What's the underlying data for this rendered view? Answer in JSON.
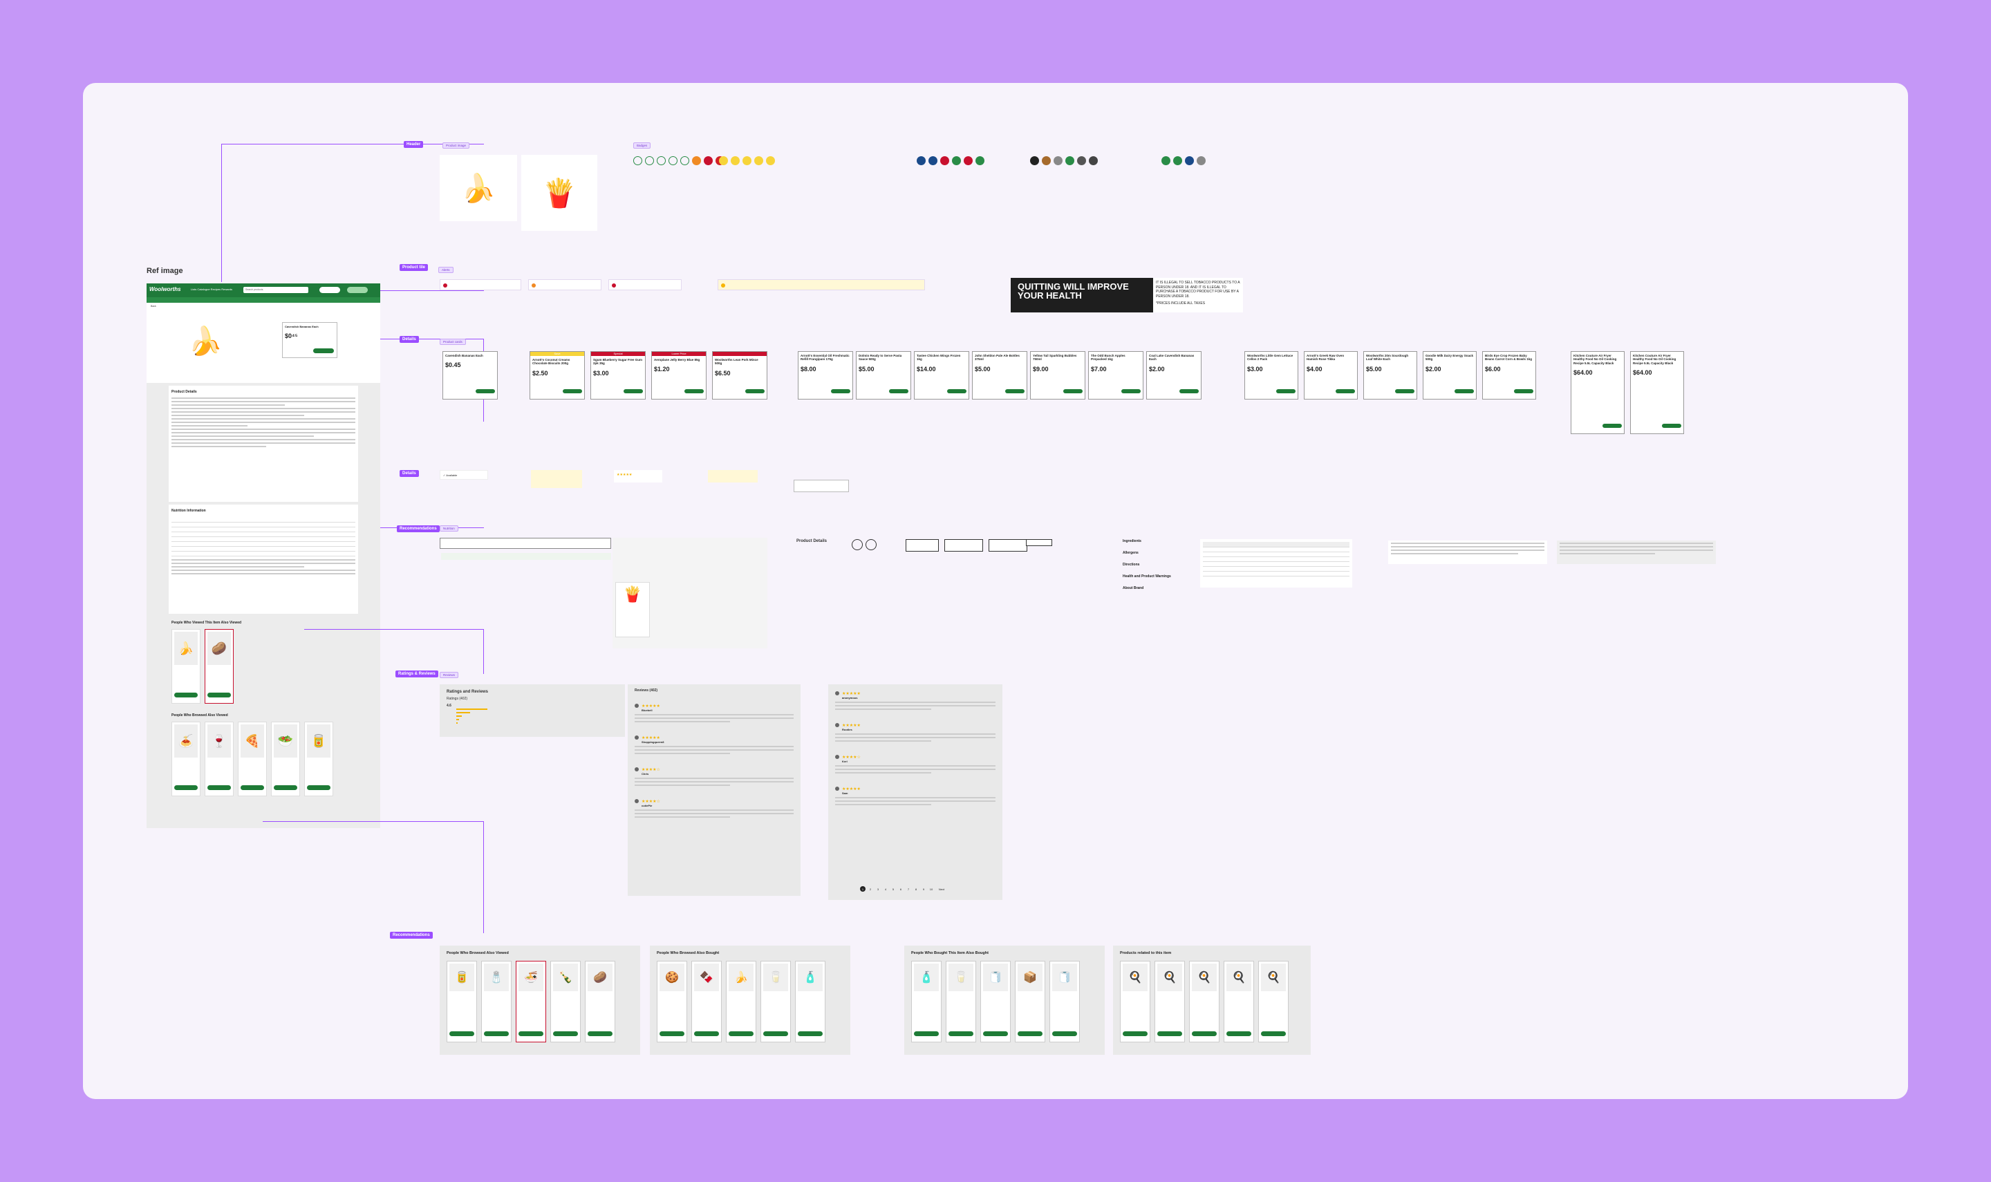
{
  "reference": {
    "title": "Ref image",
    "logo": "Woolworths",
    "nav": "Lists  Catalogue  Recipes  Rewards",
    "search_placeholder": "Search products",
    "breadcrumb": "Back",
    "product_title": "Cavendish Bananas Each",
    "product_details_heading": "Product Details",
    "nutrition_heading": "Nutrition Information",
    "also_viewed_heading": "People Who Viewed This Item Also Viewed",
    "also_browsed_heading": "People Who Browsed Also Viewed"
  },
  "sections": {
    "header": "Header",
    "product_hero": "Product tile",
    "details": "Details",
    "recommendations": "Recommendations",
    "ratings": "Ratings & Reviews"
  },
  "components": {
    "product_image": "Product image",
    "badges": "Badges",
    "alerts": "Alerts",
    "product_cards": "Product cards",
    "nutrition": "Nutrition",
    "reviews": "Reviews"
  },
  "tobacco": {
    "heading": "QUITTING WILL IMPROVE YOUR HEALTH",
    "notice": "IT IS ILLEGAL TO SELL TOBACCO PRODUCTS TO A PERSON UNDER 18. AND IT IS ILLEGAL TO PURCHASE A TOBACCO PRODUCT FOR USE BY A PERSON UNDER 18.",
    "prices": "*PRICES INCLUDE ALL TAXES"
  },
  "product_cards": [
    {
      "title": "Cavendish Bananas Each",
      "price": "$0.45",
      "tag": "",
      "tag_color": ""
    },
    {
      "title": "Arnott's Coconut Creams Chocolate Biscuits 200g",
      "price": "$2.50",
      "tag": "Save",
      "tag_color": "#f7d43a"
    },
    {
      "title": "Sgum Blueberry Sugar Free Gum 2pk 35g",
      "price": "$3.00",
      "tag": "Special",
      "tag_color": "#c8102e"
    },
    {
      "title": "Aeroplane Jelly Berry Blue 85g",
      "price": "$1.20",
      "tag": "Lower Price",
      "tag_color": "#c8102e"
    },
    {
      "title": "Woolworths Lean Pork Mince 500g",
      "price": "$6.50",
      "tag": "",
      "tag_color": "#c8102e"
    },
    {
      "title": "Arnott's Essential Oil Freshmatic Refill Frangipani 175g",
      "price": "$8.00",
      "tag": "",
      "tag_color": ""
    },
    {
      "title": "Dolmio Ready to Serve Pasta Sauce 500g",
      "price": "$5.00",
      "tag": "",
      "tag_color": ""
    },
    {
      "title": "Tastee Chicken Wings Frozen 1kg",
      "price": "$14.00",
      "tag": "",
      "tag_color": ""
    },
    {
      "title": "John Sheldon Pale Ale Bottles 375ml",
      "price": "$5.00",
      "tag": "",
      "tag_color": ""
    },
    {
      "title": "Yellow Tail Sparkling Bubbles 750ml",
      "price": "$9.00",
      "tag": "",
      "tag_color": ""
    },
    {
      "title": "The Odd Bunch Apples Prepacked 1kg",
      "price": "$7.00",
      "tag": "",
      "tag_color": ""
    },
    {
      "title": "Coal Lake Cavendish Bananas Each",
      "price": "$2.00",
      "tag": "",
      "tag_color": ""
    }
  ],
  "product_cards_2": [
    {
      "title": "Woolworths Little Gem Lettuce Cellos 2 Pack",
      "price": "$3.00"
    },
    {
      "title": "Arnott's Greek Raw Oven Hamish Rose Tikka",
      "price": "$4.00"
    },
    {
      "title": "Woolworths 20m Sourdough Loaf White Each",
      "price": "$5.00"
    },
    {
      "title": "Goodie Milk Dairy Energy Snack 500g",
      "price": "$2.00"
    },
    {
      "title": "Birds Eye Crop Frozen Baby Beans Carrot Corn & Bowls 1kg",
      "price": "$6.00"
    },
    {
      "title": "Kitchen Couture Air Fryer Healthy Food No Oil Cooking Recipe 5.5L Capacity Black",
      "price": "$64.00"
    },
    {
      "title": "Kitchen Couture Air Fryer Healthy Food No Oil Cooking Recipe 5.5L Capacity Black",
      "price": "$64.00"
    }
  ],
  "details_list": [
    "Ingredients",
    "Allergens",
    "Directions",
    "Health and Product Warnings",
    "About Brand"
  ],
  "ratings": {
    "heading": "Ratings and Reviews",
    "sub": "Ratings (402)",
    "score": "4.6",
    "reviews_heading": "Reviews (402)"
  },
  "reviews": [
    {
      "name": "Bluebell",
      "stars": "★★★★★"
    },
    {
      "name": "Shoppingqueen8",
      "stars": "★★★★★"
    },
    {
      "name": "Chris",
      "stars": "★★★★☆"
    },
    {
      "name": "cutiePie",
      "stars": "★★★★☆"
    },
    {
      "name": "anonymous",
      "stars": "★★★★★"
    },
    {
      "name": "Rootles",
      "stars": "★★★★★"
    },
    {
      "name": "Kerl",
      "stars": "★★★★☆"
    },
    {
      "name": "Sam",
      "stars": "★★★★★"
    }
  ],
  "pagination": [
    "1",
    "2",
    "3",
    "4",
    "5",
    "6",
    "7",
    "8",
    "9",
    "10",
    "Next"
  ],
  "carousels": [
    {
      "heading": "People Who Browsed Also Viewed"
    },
    {
      "heading": "People Who Browsed Also Bought"
    },
    {
      "heading": "People Who Bought This Item Also Bought"
    },
    {
      "heading": "Products related to this item"
    }
  ],
  "colors": {
    "brand_green": "#1e7b36",
    "accent_purple": "#9b4dff",
    "special_red": "#c8102e",
    "save_yellow": "#f7d43a"
  }
}
